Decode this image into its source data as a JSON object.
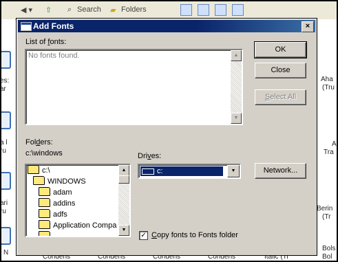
{
  "background": {
    "toolbar": {
      "search_label": "Search",
      "folders_label": "Folders"
    },
    "left_labels": [
      "es:",
      "ar",
      "a l",
      "ru",
      "ari",
      "ru",
      "i N"
    ],
    "right_labels": [
      "Aha",
      "(Tru",
      "A",
      "Tra",
      "Berin",
      "(Tr",
      "Bols",
      "Bol"
    ],
    "bottom_labels": [
      "Condens",
      "Condens",
      "Condens",
      "Condens",
      "Italic (Tr"
    ]
  },
  "dialog": {
    "title": "Add Fonts",
    "close_glyph": "×",
    "list_of_fonts_label_pre": "List of ",
    "list_of_fonts_label_u": "f",
    "list_of_fonts_label_post": "onts:",
    "fonts_list_empty": "No fonts found.",
    "folders_label_pre": "Fol",
    "folders_label_u": "d",
    "folders_label_post": "ers:",
    "current_folder": "c:\\windows",
    "folders": [
      "c:\\",
      "WINDOWS",
      "adam",
      "addins",
      "adfs",
      "Application Compa",
      "..."
    ],
    "drives_label_pre": "Dri",
    "drives_label_u": "v",
    "drives_label_post": "es:",
    "drive_selected": "c:",
    "buttons": {
      "ok": "OK",
      "close": "Close",
      "select_all_u": "S",
      "select_all_rest": "elect All",
      "network": "Network..."
    },
    "copy_fonts_u": "C",
    "copy_fonts_rest": "opy fonts to Fonts folder",
    "copy_fonts_checked": true
  }
}
